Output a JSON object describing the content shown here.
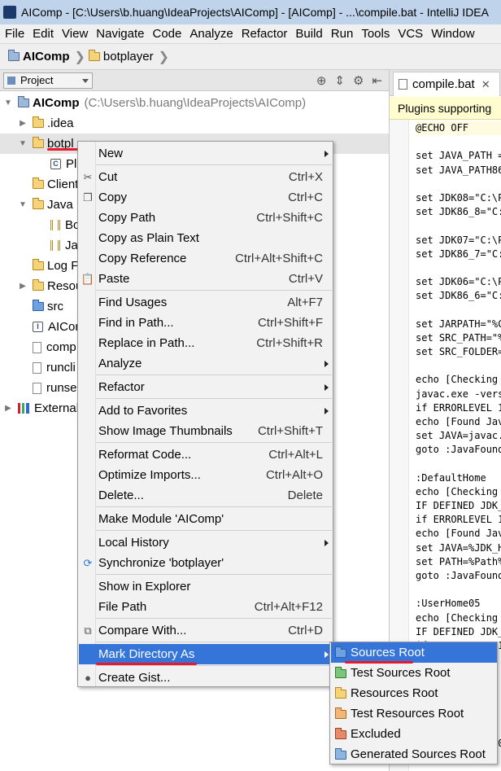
{
  "window": {
    "title": "AIComp - [C:\\Users\\b.huang\\IdeaProjects\\AIComp] - [AIComp] - ...\\compile.bat - IntelliJ IDEA"
  },
  "menubar": [
    "File",
    "Edit",
    "View",
    "Navigate",
    "Code",
    "Analyze",
    "Refactor",
    "Build",
    "Run",
    "Tools",
    "VCS",
    "Window"
  ],
  "breadcrumb": {
    "root": "AIComp",
    "child": "botplayer"
  },
  "project_panel": {
    "selector_label": "Project"
  },
  "tree": {
    "root_name": "AIComp",
    "root_path": "(C:\\Users\\b.huang\\IdeaProjects\\AIComp)",
    "items": [
      ".idea",
      "botpl",
      "Pla",
      "Client",
      "Java",
      "Bo",
      "Ja",
      "Log F",
      "Resou",
      "src",
      "AICon",
      "comp",
      "runcli",
      "runse",
      "External"
    ]
  },
  "editor": {
    "tab_label": "compile.bat",
    "banner": "Plugins supporting",
    "lines": [
      "@ECHO OFF",
      "",
      "set JAVA_PATH =",
      "set JAVA_PATH86",
      "",
      "set JDK08=\"C:\\P",
      "set JDK86_8=\"C:",
      "",
      "set JDK07=\"C:\\P",
      "set JDK86_7=\"C:",
      "",
      "set JDK06=\"C:\\P",
      "set JDK86_6=\"C:",
      "",
      "set JARPATH=\"%C",
      "set SRC_PATH=\"%",
      "set SRC_FOLDER=",
      "",
      "echo [Checking",
      "javac.exe -vers",
      "if ERRORLEVEL 1",
      "echo [Found Jav",
      "set JAVA=javac.",
      "goto :JavaFound",
      "",
      ":DefaultHome",
      "echo [Checking",
      "IF DEFINED JDK_",
      "if ERRORLEVEL 1",
      "echo [Found Jav",
      "set JAVA=%JDK_H",
      "set PATH=%Path%",
      "goto :JavaFound",
      "",
      ":UserHome05",
      "echo [Checking",
      "IF DEFINED JDK_",
      "if ERRORLEVEL 1",
      "",
      "",
      "",
      "",
      "",
      "",
      "IF DEFINED JDK0"
    ]
  },
  "context_menu": {
    "items": [
      {
        "label": "New",
        "shortcut": "",
        "submenu": true
      },
      {
        "label": "Cut",
        "shortcut": "Ctrl+X",
        "icon": "scissors-icon"
      },
      {
        "label": "Copy",
        "shortcut": "Ctrl+C",
        "icon": "copy-icon"
      },
      {
        "label": "Copy Path",
        "shortcut": "Ctrl+Shift+C"
      },
      {
        "label": "Copy as Plain Text",
        "shortcut": ""
      },
      {
        "label": "Copy Reference",
        "shortcut": "Ctrl+Alt+Shift+C"
      },
      {
        "label": "Paste",
        "shortcut": "Ctrl+V",
        "icon": "paste-icon"
      },
      {
        "label": "Find Usages",
        "shortcut": "Alt+F7"
      },
      {
        "label": "Find in Path...",
        "shortcut": "Ctrl+Shift+F"
      },
      {
        "label": "Replace in Path...",
        "shortcut": "Ctrl+Shift+R"
      },
      {
        "label": "Analyze",
        "shortcut": "",
        "submenu": true
      },
      {
        "label": "Refactor",
        "shortcut": "",
        "submenu": true
      },
      {
        "label": "Add to Favorites",
        "shortcut": "",
        "submenu": true
      },
      {
        "label": "Show Image Thumbnails",
        "shortcut": "Ctrl+Shift+T"
      },
      {
        "label": "Reformat Code...",
        "shortcut": "Ctrl+Alt+L"
      },
      {
        "label": "Optimize Imports...",
        "shortcut": "Ctrl+Alt+O"
      },
      {
        "label": "Delete...",
        "shortcut": "Delete"
      },
      {
        "label": "Make Module 'AIComp'",
        "shortcut": ""
      },
      {
        "label": "Local History",
        "shortcut": "",
        "submenu": true
      },
      {
        "label": "Synchronize 'botplayer'",
        "shortcut": "",
        "icon": "sync-icon"
      },
      {
        "label": "Show in Explorer",
        "shortcut": ""
      },
      {
        "label": "File Path",
        "shortcut": "Ctrl+Alt+F12"
      },
      {
        "label": "Compare With...",
        "shortcut": "Ctrl+D",
        "icon": "compare-icon"
      },
      {
        "label": "Mark Directory As",
        "shortcut": "",
        "submenu": true,
        "active": true
      },
      {
        "label": "Create Gist...",
        "shortcut": "",
        "icon": "github-icon"
      }
    ]
  },
  "mark_directory_submenu": {
    "items": [
      {
        "label": "Sources Root",
        "active": true
      },
      {
        "label": "Test Sources Root"
      },
      {
        "label": "Resources Root"
      },
      {
        "label": "Test Resources Root"
      },
      {
        "label": "Excluded"
      },
      {
        "label": "Generated Sources Root"
      }
    ]
  },
  "colors": {
    "selection": "#3575d9",
    "annotation": "#e8192c"
  }
}
